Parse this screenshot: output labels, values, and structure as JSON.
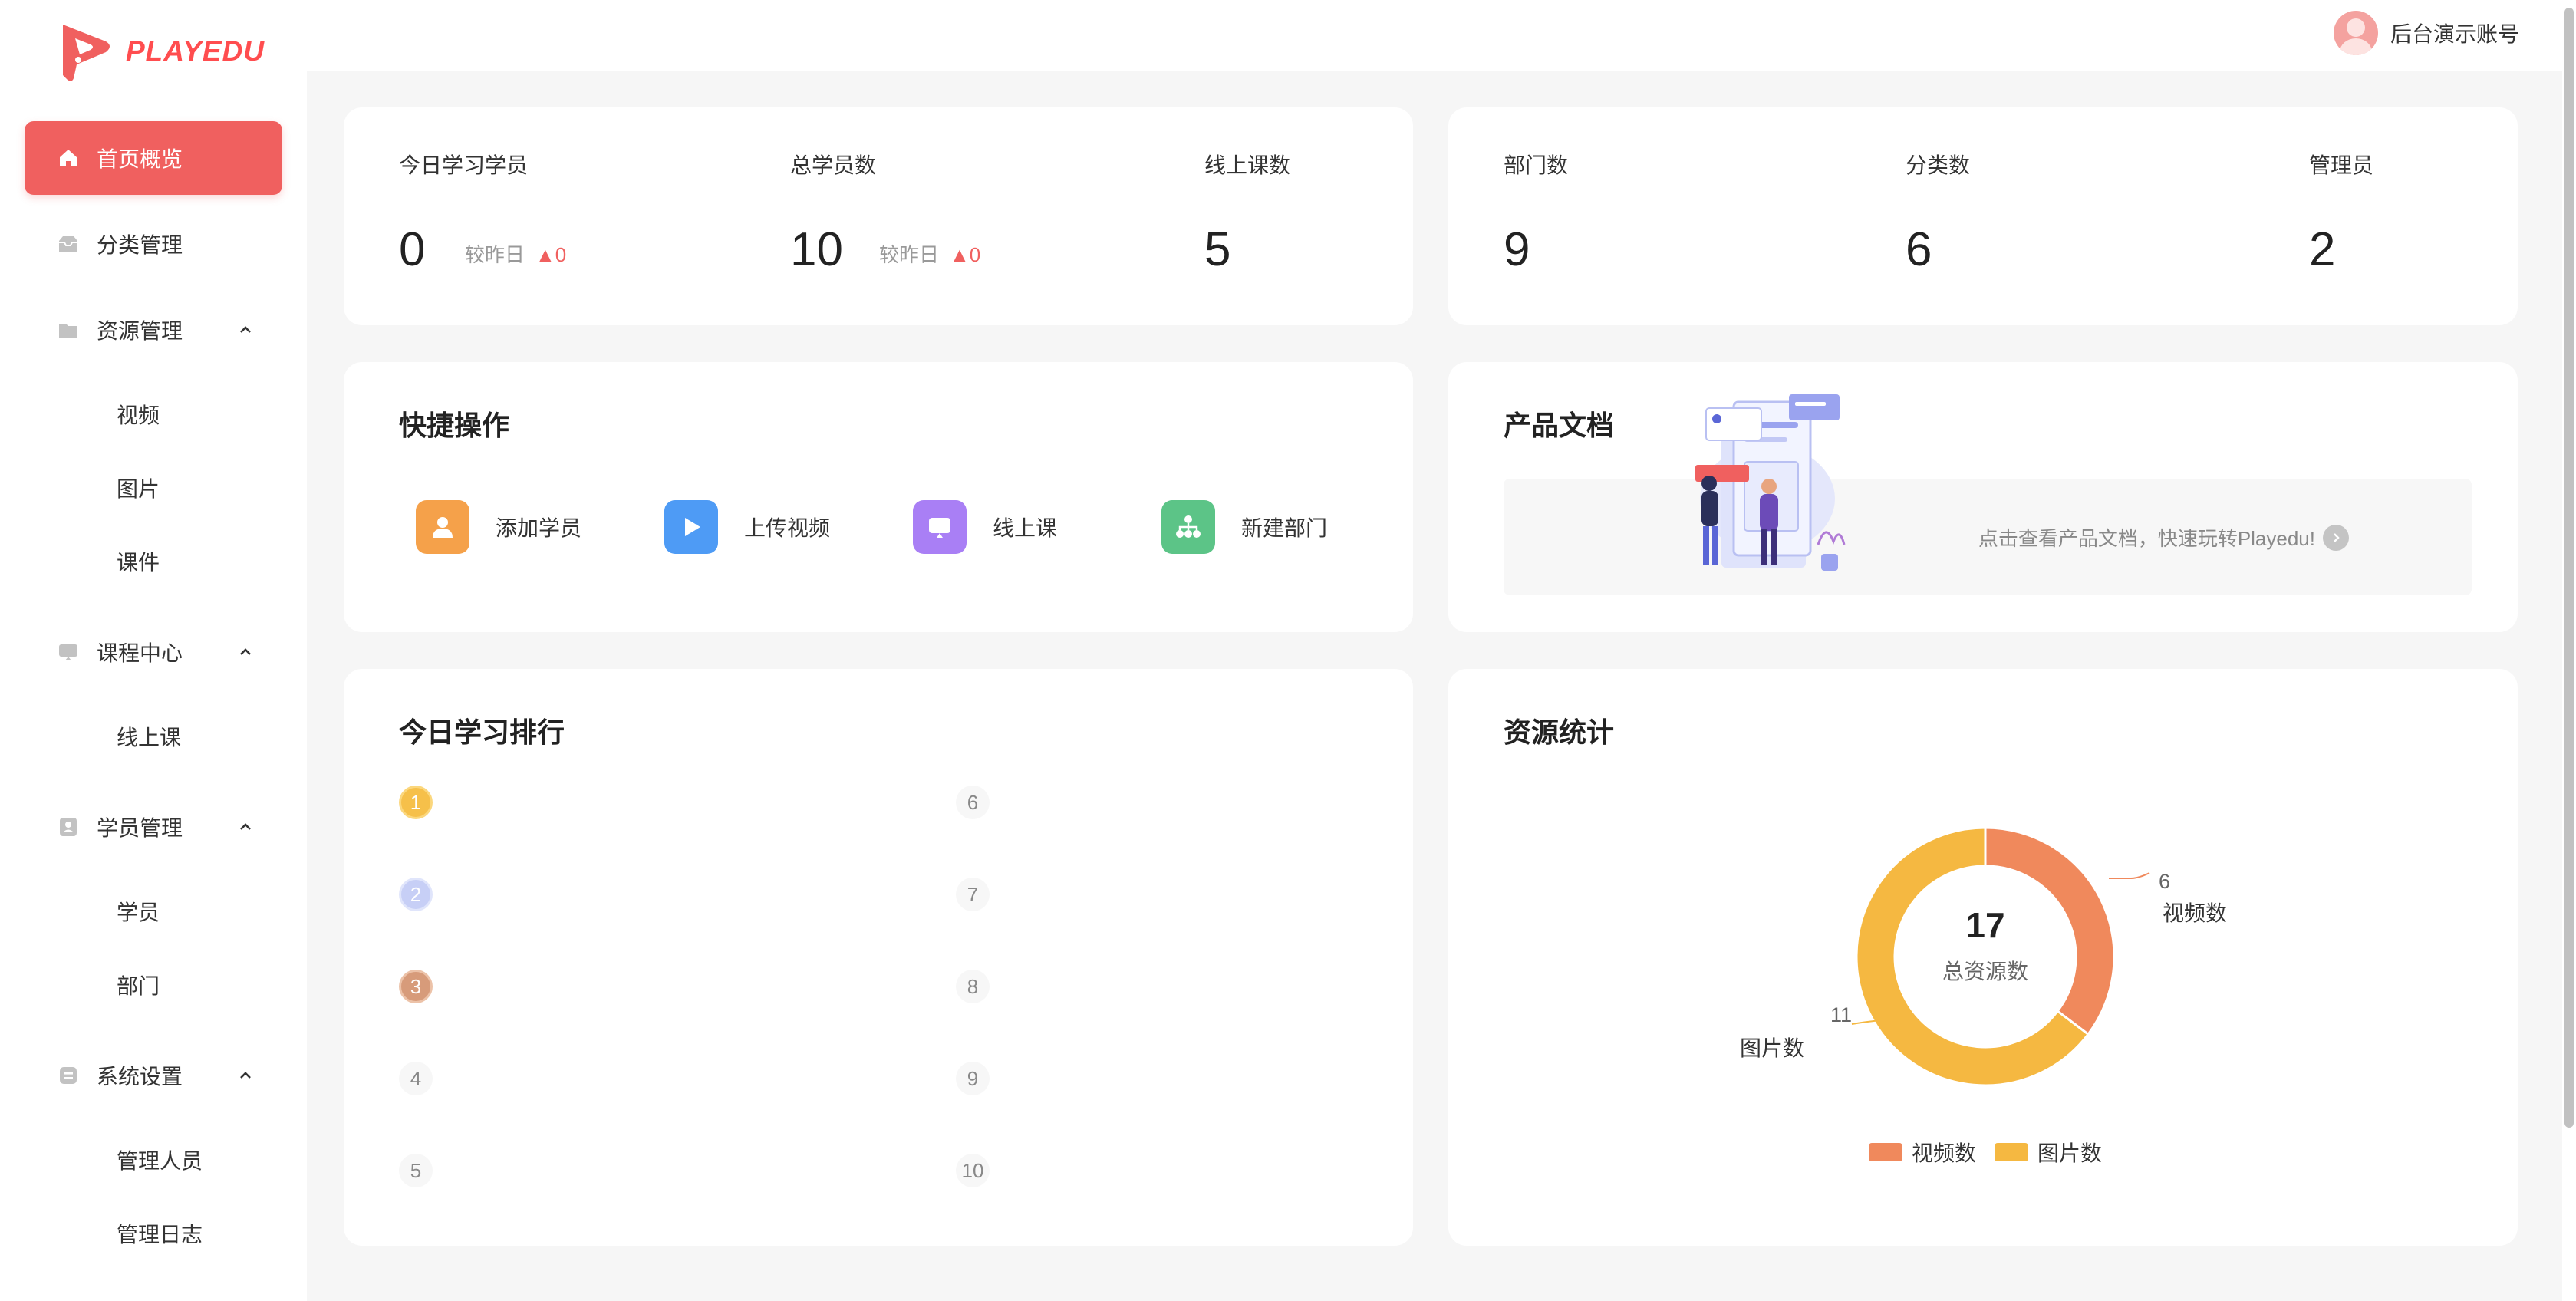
{
  "brand": {
    "name": "PLAYEDU",
    "color": "#ff4d4f"
  },
  "header": {
    "user_name": "后台演示账号"
  },
  "sidebar": {
    "items": [
      {
        "label": "首页概览",
        "icon": "home-icon",
        "active": true
      },
      {
        "label": "分类管理",
        "icon": "inbox-icon"
      },
      {
        "label": "资源管理",
        "icon": "folder-icon",
        "expanded": true,
        "children": [
          "视频",
          "图片",
          "课件"
        ]
      },
      {
        "label": "课程中心",
        "icon": "monitor-icon",
        "expanded": true,
        "children": [
          "线上课"
        ]
      },
      {
        "label": "学员管理",
        "icon": "user-card-icon",
        "expanded": true,
        "children": [
          "学员",
          "部门"
        ]
      },
      {
        "label": "系统设置",
        "icon": "settings-icon",
        "expanded": true,
        "children": [
          "管理人员",
          "管理日志"
        ]
      }
    ]
  },
  "stats_left": {
    "today_learners": {
      "label": "今日学习学员",
      "value": "0",
      "compare_label": "较昨日",
      "delta": "▲0"
    },
    "total_learners": {
      "label": "总学员数",
      "value": "10",
      "compare_label": "较昨日",
      "delta": "▲0"
    },
    "online_courses": {
      "label": "线上课数",
      "value": "5"
    }
  },
  "stats_right": {
    "departments": {
      "label": "部门数",
      "value": "9"
    },
    "categories": {
      "label": "分类数",
      "value": "6"
    },
    "admins": {
      "label": "管理员",
      "value": "2"
    }
  },
  "quick_actions": {
    "title": "快捷操作",
    "items": [
      {
        "label": "添加学员",
        "icon": "add-user-icon",
        "color": "#f5a14a"
      },
      {
        "label": "上传视频",
        "icon": "play-icon",
        "color": "#4e9bf5"
      },
      {
        "label": "线上课",
        "icon": "screen-icon",
        "color": "#a97ff5"
      },
      {
        "label": "新建部门",
        "icon": "org-tree-icon",
        "color": "#5cc487"
      }
    ]
  },
  "docs": {
    "title": "产品文档",
    "link_text": "点击查看产品文档，快速玩转Playedu!"
  },
  "ranking": {
    "title": "今日学习排行",
    "left": [
      "1",
      "2",
      "3",
      "4",
      "5"
    ],
    "right": [
      "6",
      "7",
      "8",
      "9",
      "10"
    ]
  },
  "resources": {
    "title": "资源统计",
    "center_value": "17",
    "center_label": "总资源数",
    "video_label_value": "6",
    "video_label_name": "视频数",
    "image_label_value": "11",
    "image_label_name": "图片数"
  },
  "chart_data": {
    "type": "pie",
    "donut": true,
    "categories": [
      "视频数",
      "图片数"
    ],
    "values": [
      6,
      11
    ],
    "colors": [
      "#f0895c",
      "#f5b841"
    ],
    "total": 17,
    "center_label": "总资源数",
    "legend": "bottom"
  }
}
